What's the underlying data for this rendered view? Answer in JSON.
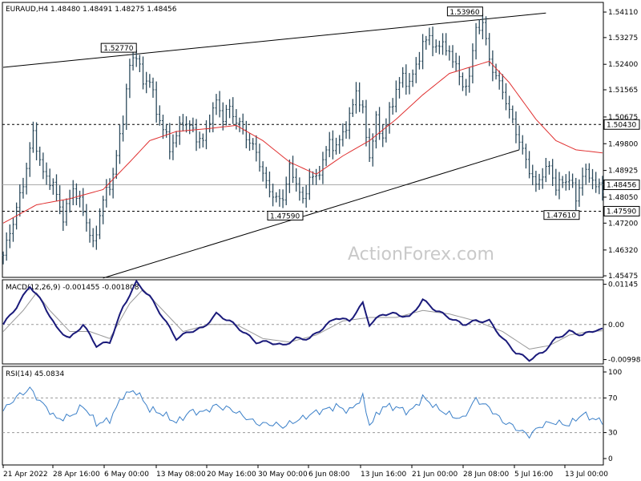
{
  "watermark": "ActionForex.com",
  "chart_data": [
    {
      "type": "line",
      "panel": "price",
      "symbol": "EURAUD",
      "timeframe": "H4",
      "title": "EURAUD,H4  1.48480 1.48491 1.48275 1.48456",
      "ohlc": {
        "open": 1.4848,
        "high": 1.48491,
        "low": 1.48275,
        "close": 1.48456
      },
      "ylim": [
        1.4545,
        1.544
      ],
      "y_ticks": [
        1.5411,
        1.53275,
        1.524,
        1.51565,
        1.50675,
        1.498,
        1.48925,
        1.4805,
        1.472,
        1.4632,
        1.45475
      ],
      "x_ticks": [
        "21 Apr 2022",
        "28 Apr 16:00",
        "6 May 00:00",
        "13 May 08:00",
        "20 May 16:00",
        "30 May 00:00",
        "6 Jun 08:00",
        "13 Jun 16:00",
        "21 Jun 00:00",
        "28 Jun 08:00",
        "5 Jul 16:00",
        "13 Jul 00:00"
      ],
      "price_keypoints": [
        [
          0,
          1.4615
        ],
        [
          3,
          1.472
        ],
        [
          6,
          1.485
        ],
        [
          9,
          1.502
        ],
        [
          12,
          1.488
        ],
        [
          15,
          1.484
        ],
        [
          18,
          1.474
        ],
        [
          21,
          1.484
        ],
        [
          24,
          1.476
        ],
        [
          27,
          1.464
        ],
        [
          30,
          1.48
        ],
        [
          33,
          1.488
        ],
        [
          36,
          1.506
        ],
        [
          38,
          1.523
        ],
        [
          40,
          1.5277
        ],
        [
          42,
          1.518
        ],
        [
          44,
          1.52
        ],
        [
          46,
          1.508
        ],
        [
          48,
          1.503
        ],
        [
          50,
          1.496
        ],
        [
          52,
          1.501
        ],
        [
          54,
          1.506
        ],
        [
          56,
          1.504
        ],
        [
          58,
          1.5
        ],
        [
          60,
          1.498
        ],
        [
          62,
          1.506
        ],
        [
          64,
          1.512
        ],
        [
          66,
          1.507
        ],
        [
          68,
          1.51
        ],
        [
          70,
          1.505
        ],
        [
          72,
          1.502
        ],
        [
          74,
          1.498
        ],
        [
          76,
          1.496
        ],
        [
          78,
          1.488
        ],
        [
          80,
          1.483
        ],
        [
          82,
          1.479
        ],
        [
          84,
          1.48
        ],
        [
          86,
          1.49
        ],
        [
          88,
          1.486
        ],
        [
          90,
          1.479
        ],
        [
          92,
          1.487
        ],
        [
          94,
          1.486
        ],
        [
          96,
          1.492
        ],
        [
          98,
          1.499
        ],
        [
          100,
          1.497
        ],
        [
          102,
          1.502
        ],
        [
          104,
          1.506
        ],
        [
          106,
          1.515
        ],
        [
          108,
          1.508
        ],
        [
          110,
          1.494
        ],
        [
          112,
          1.506
        ],
        [
          114,
          1.5
        ],
        [
          116,
          1.508
        ],
        [
          118,
          1.515
        ],
        [
          120,
          1.52
        ],
        [
          122,
          1.518
        ],
        [
          124,
          1.524
        ],
        [
          126,
          1.53
        ],
        [
          128,
          1.533
        ],
        [
          130,
          1.528
        ],
        [
          132,
          1.532
        ],
        [
          134,
          1.527
        ],
        [
          136,
          1.525
        ],
        [
          138,
          1.515
        ],
        [
          140,
          1.52
        ],
        [
          142,
          1.535
        ],
        [
          144,
          1.538
        ],
        [
          146,
          1.526
        ],
        [
          148,
          1.52
        ],
        [
          150,
          1.515
        ],
        [
          152,
          1.508
        ],
        [
          154,
          1.502
        ],
        [
          156,
          1.496
        ],
        [
          158,
          1.49
        ],
        [
          160,
          1.484
        ],
        [
          162,
          1.488
        ],
        [
          164,
          1.49
        ],
        [
          166,
          1.484
        ],
        [
          168,
          1.486
        ],
        [
          170,
          1.487
        ],
        [
          172,
          1.48
        ],
        [
          174,
          1.487
        ],
        [
          176,
          1.488
        ],
        [
          178,
          1.484
        ],
        [
          180,
          1.4846
        ]
      ],
      "sma_keypoints": [
        [
          0,
          1.472
        ],
        [
          10,
          1.478
        ],
        [
          20,
          1.48
        ],
        [
          30,
          1.483
        ],
        [
          38,
          1.492
        ],
        [
          44,
          1.499
        ],
        [
          52,
          1.502
        ],
        [
          62,
          1.503
        ],
        [
          70,
          1.504
        ],
        [
          78,
          1.499
        ],
        [
          86,
          1.492
        ],
        [
          94,
          1.488
        ],
        [
          102,
          1.494
        ],
        [
          110,
          1.499
        ],
        [
          118,
          1.506
        ],
        [
          126,
          1.514
        ],
        [
          134,
          1.521
        ],
        [
          140,
          1.523
        ],
        [
          146,
          1.525
        ],
        [
          152,
          1.518
        ],
        [
          160,
          1.506
        ],
        [
          166,
          1.499
        ],
        [
          172,
          1.496
        ],
        [
          180,
          1.495
        ]
      ],
      "sma_color": "#e03030",
      "price_color": "#2c4a5c",
      "annotations": [
        {
          "label": "1.52770",
          "x_index": 40,
          "price": 1.5277
        },
        {
          "label": "1.53960",
          "x_index": 144,
          "price": 1.5396
        },
        {
          "label": "1.47590",
          "x_index": 90,
          "price": 1.4759
        },
        {
          "label": "1.47610",
          "x_index": 173,
          "price": 1.4761
        }
      ],
      "horizontal_levels": [
        {
          "label": "1.50430",
          "price": 1.5043,
          "style": "dashed"
        },
        {
          "label": "1.48456",
          "price": 1.48456,
          "style": "solid-gray",
          "current": true
        },
        {
          "label": "1.47590",
          "price": 1.4759,
          "style": "dashed"
        }
      ],
      "trendlines": [
        {
          "from": [
            0,
            1.523
          ],
          "to": [
            163,
            1.5408
          ]
        },
        {
          "from": [
            30,
            1.454
          ],
          "to": [
            155,
            1.496
          ]
        }
      ]
    },
    {
      "type": "line",
      "panel": "macd",
      "title": "MACD(12,26,9) -0.001455 -0.001808",
      "params": [
        12,
        26,
        9
      ],
      "macd_value": -0.001455,
      "signal_value": -0.001808,
      "ylim": [
        -0.011,
        0.0125
      ],
      "y_ticks": [
        {
          "label": "0.01145",
          "value": 0.01145
        },
        {
          "label": "0.00",
          "value": 0.0
        },
        {
          "label": "-0.009985",
          "value": -0.009985
        }
      ],
      "macd_keypoints": [
        [
          0,
          0.0
        ],
        [
          4,
          0.005
        ],
        [
          8,
          0.011
        ],
        [
          12,
          0.006
        ],
        [
          16,
          -0.001
        ],
        [
          20,
          -0.004
        ],
        [
          24,
          0.0
        ],
        [
          28,
          -0.006
        ],
        [
          32,
          -0.005
        ],
        [
          36,
          0.005
        ],
        [
          40,
          0.012
        ],
        [
          44,
          0.008
        ],
        [
          48,
          0.002
        ],
        [
          52,
          -0.004
        ],
        [
          56,
          -0.002
        ],
        [
          60,
          -0.001
        ],
        [
          64,
          0.003
        ],
        [
          68,
          0.001
        ],
        [
          72,
          -0.002
        ],
        [
          76,
          -0.005
        ],
        [
          80,
          -0.005
        ],
        [
          84,
          -0.006
        ],
        [
          88,
          -0.004
        ],
        [
          92,
          -0.004
        ],
        [
          96,
          -0.001
        ],
        [
          100,
          0.002
        ],
        [
          104,
          0.001
        ],
        [
          108,
          0.006
        ],
        [
          110,
          0.0
        ],
        [
          114,
          0.003
        ],
        [
          118,
          0.003
        ],
        [
          122,
          0.002
        ],
        [
          126,
          0.007
        ],
        [
          130,
          0.004
        ],
        [
          134,
          0.002
        ],
        [
          138,
          0.0
        ],
        [
          142,
          0.001
        ],
        [
          146,
          0.001
        ],
        [
          150,
          -0.004
        ],
        [
          154,
          -0.008
        ],
        [
          158,
          -0.01
        ],
        [
          162,
          -0.008
        ],
        [
          166,
          -0.004
        ],
        [
          170,
          -0.002
        ],
        [
          174,
          -0.003
        ],
        [
          178,
          -0.0015
        ],
        [
          180,
          -0.0015
        ]
      ],
      "signal_keypoints": [
        [
          0,
          -0.002
        ],
        [
          6,
          0.004
        ],
        [
          10,
          0.009
        ],
        [
          14,
          0.004
        ],
        [
          20,
          -0.002
        ],
        [
          26,
          -0.002
        ],
        [
          32,
          -0.004
        ],
        [
          38,
          0.006
        ],
        [
          42,
          0.01
        ],
        [
          48,
          0.004
        ],
        [
          54,
          -0.002
        ],
        [
          62,
          0.0
        ],
        [
          70,
          0.0
        ],
        [
          78,
          -0.004
        ],
        [
          86,
          -0.005
        ],
        [
          94,
          -0.003
        ],
        [
          102,
          0.001
        ],
        [
          110,
          0.002
        ],
        [
          118,
          0.002
        ],
        [
          126,
          0.004
        ],
        [
          134,
          0.003
        ],
        [
          142,
          0.001
        ],
        [
          150,
          -0.002
        ],
        [
          158,
          -0.007
        ],
        [
          164,
          -0.006
        ],
        [
          170,
          -0.003
        ],
        [
          176,
          -0.002
        ],
        [
          180,
          -0.0018
        ]
      ],
      "macd_color": "#1a1a7a",
      "signal_color": "#999999"
    },
    {
      "type": "line",
      "panel": "rsi",
      "title": "RSI(14) 45.0834",
      "period": 14,
      "value": 45.0834,
      "ylim": [
        0,
        100
      ],
      "y_ticks": [
        {
          "label": "100",
          "value": 100
        },
        {
          "label": "70",
          "value": 70
        },
        {
          "label": "30",
          "value": 30
        },
        {
          "label": "0",
          "value": 0
        }
      ],
      "levels": [
        70,
        30
      ],
      "rsi_keypoints": [
        [
          0,
          55
        ],
        [
          4,
          70
        ],
        [
          8,
          82
        ],
        [
          12,
          62
        ],
        [
          16,
          45
        ],
        [
          20,
          50
        ],
        [
          24,
          60
        ],
        [
          28,
          40
        ],
        [
          32,
          46
        ],
        [
          36,
          72
        ],
        [
          40,
          78
        ],
        [
          44,
          58
        ],
        [
          48,
          50
        ],
        [
          52,
          42
        ],
        [
          56,
          55
        ],
        [
          60,
          52
        ],
        [
          64,
          62
        ],
        [
          68,
          58
        ],
        [
          72,
          48
        ],
        [
          76,
          42
        ],
        [
          80,
          40
        ],
        [
          84,
          36
        ],
        [
          88,
          45
        ],
        [
          92,
          50
        ],
        [
          96,
          55
        ],
        [
          100,
          62
        ],
        [
          104,
          54
        ],
        [
          108,
          70
        ],
        [
          110,
          40
        ],
        [
          114,
          60
        ],
        [
          118,
          58
        ],
        [
          122,
          55
        ],
        [
          126,
          70
        ],
        [
          130,
          58
        ],
        [
          134,
          52
        ],
        [
          138,
          45
        ],
        [
          142,
          68
        ],
        [
          146,
          60
        ],
        [
          150,
          42
        ],
        [
          154,
          35
        ],
        [
          158,
          28
        ],
        [
          162,
          38
        ],
        [
          166,
          42
        ],
        [
          170,
          40
        ],
        [
          174,
          50
        ],
        [
          178,
          45
        ],
        [
          180,
          45.1
        ]
      ],
      "rsi_color": "#3a7fc8"
    }
  ]
}
